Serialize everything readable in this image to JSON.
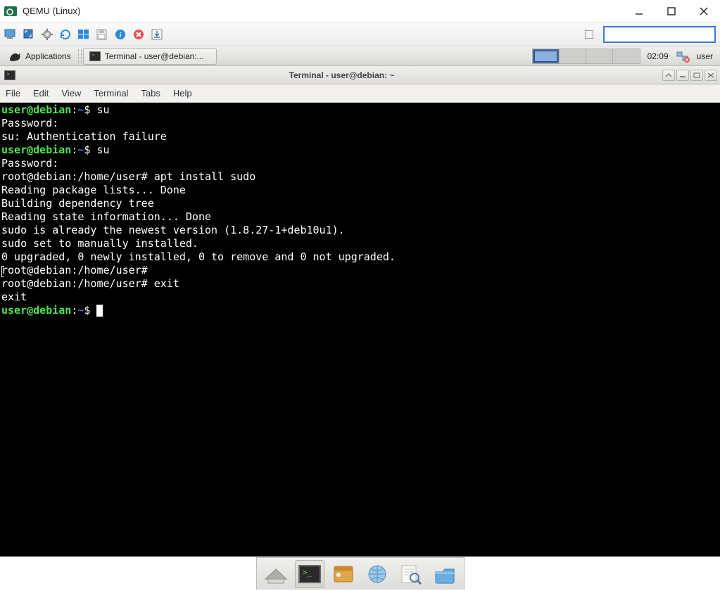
{
  "host": {
    "title": "QEMU (Linux)",
    "toolbar_icons": [
      "monitor-icon",
      "fullscreen-icon",
      "gear-icon",
      "refresh-icon",
      "windows-icon",
      "floppy-icon",
      "info-icon",
      "close-round-icon",
      "download-icon"
    ]
  },
  "xfce": {
    "applications_label": "Applications",
    "task_label": "Terminal - user@debian:...",
    "clock": "02:09",
    "username": "user",
    "workspaces": 4,
    "active_workspace": 0
  },
  "term_window": {
    "title": "Terminal - user@debian: ~"
  },
  "term_menu": {
    "items": [
      "File",
      "Edit",
      "View",
      "Terminal",
      "Tabs",
      "Help"
    ]
  },
  "term_lines": [
    {
      "type": "prompt_user",
      "cmd": "su"
    },
    {
      "type": "text",
      "text": "Password: "
    },
    {
      "type": "text",
      "text": "su: Authentication failure"
    },
    {
      "type": "prompt_user",
      "cmd": "su"
    },
    {
      "type": "text",
      "text": "Password: "
    },
    {
      "type": "prompt_root",
      "cmd": "apt install sudo"
    },
    {
      "type": "text",
      "text": "Reading package lists... Done"
    },
    {
      "type": "text",
      "text": "Building dependency tree       "
    },
    {
      "type": "text",
      "text": "Reading state information... Done"
    },
    {
      "type": "text",
      "text": "sudo is already the newest version (1.8.27-1+deb10u1)."
    },
    {
      "type": "text",
      "text": "sudo set to manually installed."
    },
    {
      "type": "text",
      "text": "0 upgraded, 0 newly installed, 0 to remove and 0 not upgraded."
    },
    {
      "type": "prompt_root_ibeam",
      "cmd": ""
    },
    {
      "type": "prompt_root",
      "cmd": "exit"
    },
    {
      "type": "text",
      "text": "exit"
    },
    {
      "type": "prompt_user_cursor",
      "cmd": ""
    }
  ],
  "prompts": {
    "user_userhost": "user@debian",
    "user_colon": ":",
    "user_path": "~",
    "user_sym": "$ ",
    "root_prefix": "root@debian:/home/user# "
  },
  "dock": {
    "items": [
      {
        "name": "show-desktop-icon",
        "active": false
      },
      {
        "name": "terminal-icon",
        "active": true
      },
      {
        "name": "file-manager-icon",
        "active": false
      },
      {
        "name": "web-browser-icon",
        "active": false
      },
      {
        "name": "app-finder-icon",
        "active": false
      },
      {
        "name": "home-folder-icon",
        "active": false
      }
    ]
  }
}
